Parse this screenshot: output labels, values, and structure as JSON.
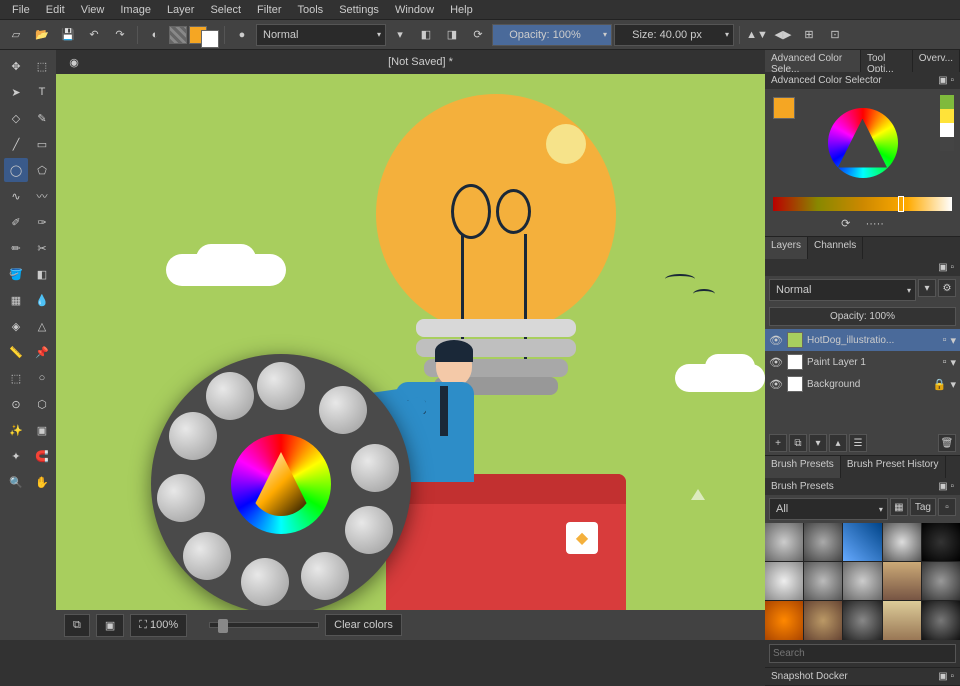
{
  "menu": [
    "File",
    "Edit",
    "View",
    "Image",
    "Layer",
    "Select",
    "Filter",
    "Tools",
    "Settings",
    "Window",
    "Help"
  ],
  "toolbar": {
    "blend_mode": "Normal",
    "opacity_label": "Opacity: 100%",
    "size_label": "Size: 40.00 px",
    "fg_color": "#f5a623",
    "bg_color": "#ffffff"
  },
  "document": {
    "title": "[Not Saved]  *"
  },
  "canvas_footer": {
    "zoom": "100%",
    "clear": "Clear colors"
  },
  "panels": {
    "tabs": [
      "Advanced Color Sele...",
      "Tool Opti...",
      "Overv..."
    ],
    "color_title": "Advanced Color Selector",
    "layers_tab": "Layers",
    "channels_tab": "Channels",
    "layers_blend": "Normal",
    "layers_opacity": "Opacity:   100%",
    "layers": [
      {
        "name": "HotDog_illustratio...",
        "selected": true,
        "locked": false
      },
      {
        "name": "Paint Layer 1",
        "selected": false,
        "locked": false
      },
      {
        "name": "Background",
        "selected": false,
        "locked": true
      }
    ],
    "brush_tab1": "Brush Presets",
    "brush_tab2": "Brush Preset History",
    "brush_title": "Brush Presets",
    "brush_filter": "All",
    "brush_tag": "Tag",
    "search_placeholder": "Search",
    "snapshot_title": "Snapshot Docker"
  },
  "swatches": [
    "#7fba3c",
    "#ffe339",
    "#ffffff",
    "#444444"
  ]
}
